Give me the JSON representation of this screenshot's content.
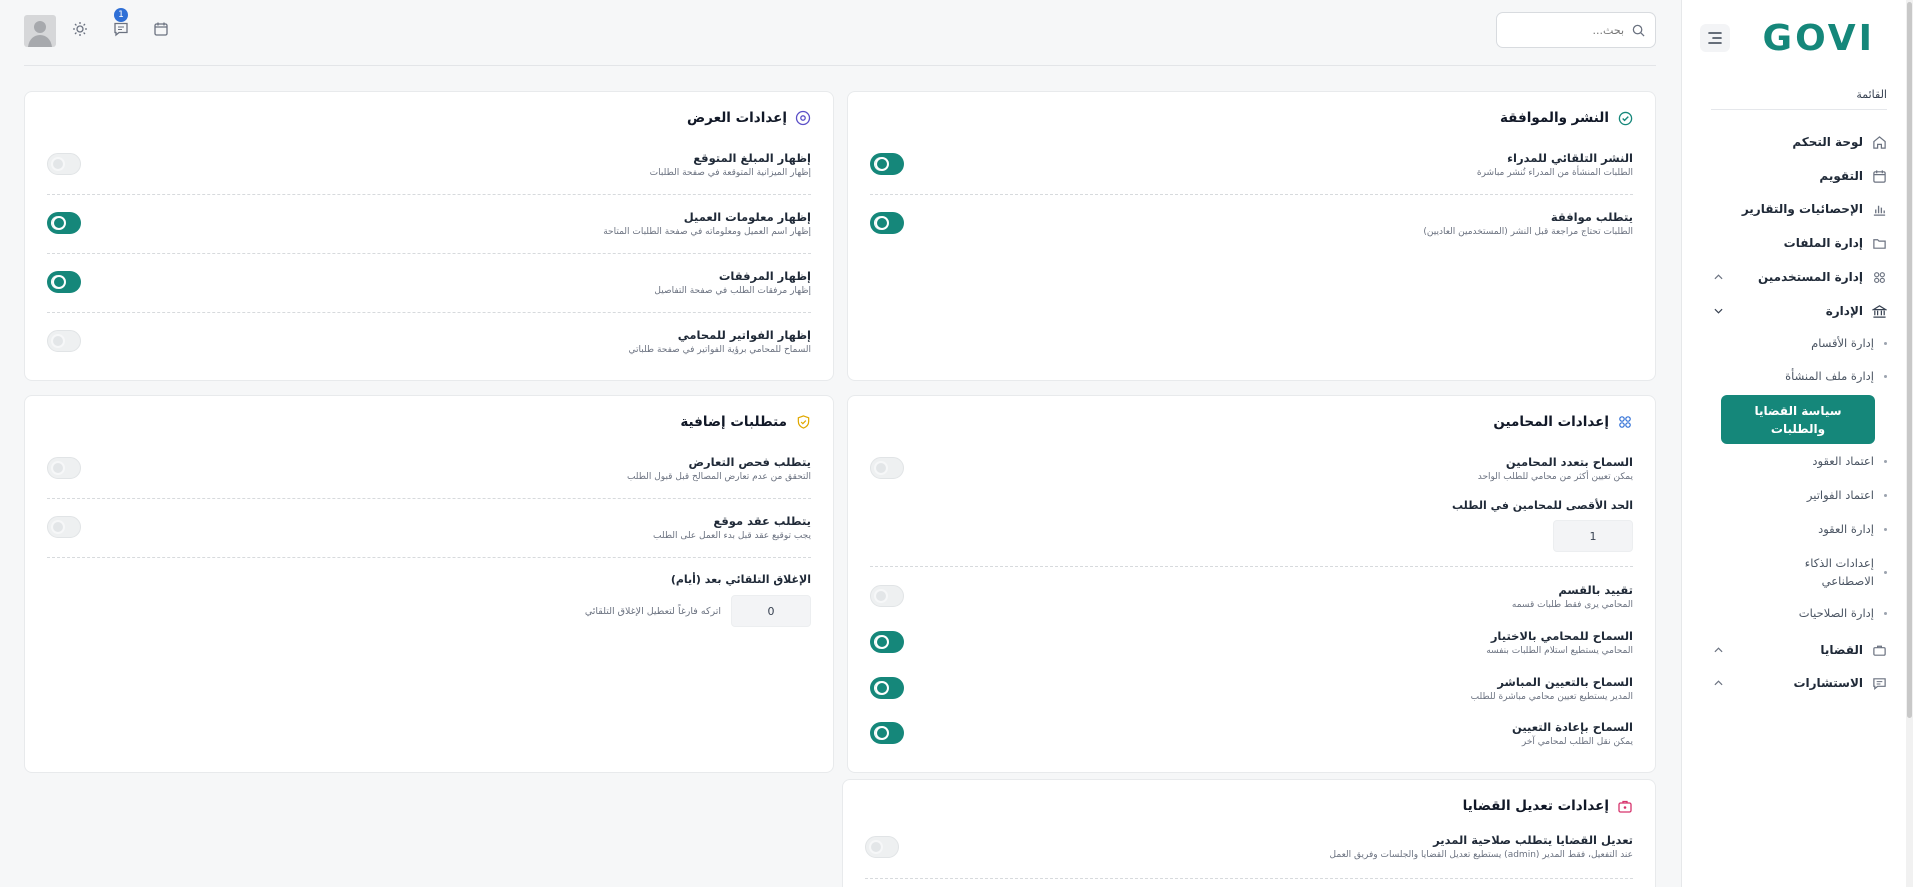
{
  "brand": {
    "logo_text": "GOVI",
    "accent": "#15877a"
  },
  "sidebar": {
    "menu_title": "القائمة",
    "items": [
      {
        "label": "لوحة التحكم",
        "icon": "home-icon"
      },
      {
        "label": "التقويم",
        "icon": "calendar-icon"
      },
      {
        "label": "الإحصائيات والتقارير",
        "icon": "bar-chart-icon"
      },
      {
        "label": "إدارة الملفات",
        "icon": "folder-icon"
      },
      {
        "label": "إدارة المستخدمين",
        "icon": "users-icon"
      },
      {
        "label": "الإدارة",
        "icon": "bank-icon"
      },
      {
        "label": "القضايا",
        "icon": "briefcase-icon"
      },
      {
        "label": "الاستشارات",
        "icon": "chat-icon"
      }
    ],
    "sub_items": [
      "إدارة الأقسام",
      "إدارة ملف المنشأة",
      "سياسة القضايا والطلبات",
      "اعتماد العقود",
      "اعتماد الفواتير",
      "إدارة العقود",
      "إعدادات الذكاء الاصطناعي",
      "إدارة الصلاحيات"
    ]
  },
  "topbar": {
    "search_placeholder": "بحث...",
    "notification_count": "1"
  },
  "publishing": {
    "title": "النشر والموافقة",
    "rows": [
      {
        "title": "النشر التلقائي للمدراء",
        "desc": "الطلبات المنشأة من المدراء تُنشر مباشرة",
        "on": true
      },
      {
        "title": "يتطلب موافقة",
        "desc": "الطلبات تحتاج مراجعة قبل النشر (المستخدمين العاديين)",
        "on": true
      }
    ]
  },
  "display": {
    "title": "إعدادات العرض",
    "rows": [
      {
        "title": "إظهار المبلغ المتوقع",
        "desc": "إظهار الميزانية المتوقعة في صفحة الطلبات",
        "on": false
      },
      {
        "title": "إظهار معلومات العميل",
        "desc": "إظهار اسم العميل ومعلوماته في صفحة الطلبات المتاحة",
        "on": true
      },
      {
        "title": "إظهار المرفقات",
        "desc": "إظهار مرفقات الطلب في صفحة التفاصيل",
        "on": true
      },
      {
        "title": "إظهار الفواتير للمحامي",
        "desc": "السماح للمحامي برؤية الفواتير في صفحة طلباتي",
        "on": false
      }
    ]
  },
  "lawyers": {
    "title": "إعدادات المحامين",
    "multi": {
      "title": "السماح بتعدد المحامين",
      "desc": "يمكن تعيين أكثر من محامي للطلب الواحد",
      "on": false
    },
    "max_label": "الحد الأقصى للمحامين في الطلب",
    "max_value": "1",
    "rows": [
      {
        "title": "تقييد بالقسم",
        "desc": "المحامي يرى فقط طلبات قسمه",
        "on": false
      },
      {
        "title": "السماح للمحامي بالاختيار",
        "desc": "المحامي يستطيع استلام الطلبات بنفسه",
        "on": true
      },
      {
        "title": "السماح بالتعيين المباشر",
        "desc": "المدير يستطيع تعيين محامي مباشرة للطلب",
        "on": true
      },
      {
        "title": "السماح بإعادة التعيين",
        "desc": "يمكن نقل الطلب لمحامي آخر",
        "on": true
      }
    ]
  },
  "extra": {
    "title": "متطلبات إضافية",
    "rows": [
      {
        "title": "يتطلب فحص التعارض",
        "desc": "التحقق من عدم تعارض المصالح قبل قبول الطلب",
        "on": false
      },
      {
        "title": "يتطلب عقد موقع",
        "desc": "يجب توقيع عقد قبل بدء العمل على الطلب",
        "on": false
      }
    ],
    "auto_close_label": "الإغلاق التلقائي بعد (أيام)",
    "auto_close_value": "0",
    "auto_close_hint": "اتركه فارغاً لتعطيل الإغلاق التلقائي"
  },
  "case_edit": {
    "title": "إعدادات تعديل القضايا",
    "rows": [
      {
        "title": "تعديل القضايا يتطلب صلاحية المدير",
        "desc": "عند التفعيل، فقط المدير (admin) يستطيع تعديل القضايا والجلسات وفريق العمل",
        "on": false
      }
    ]
  }
}
